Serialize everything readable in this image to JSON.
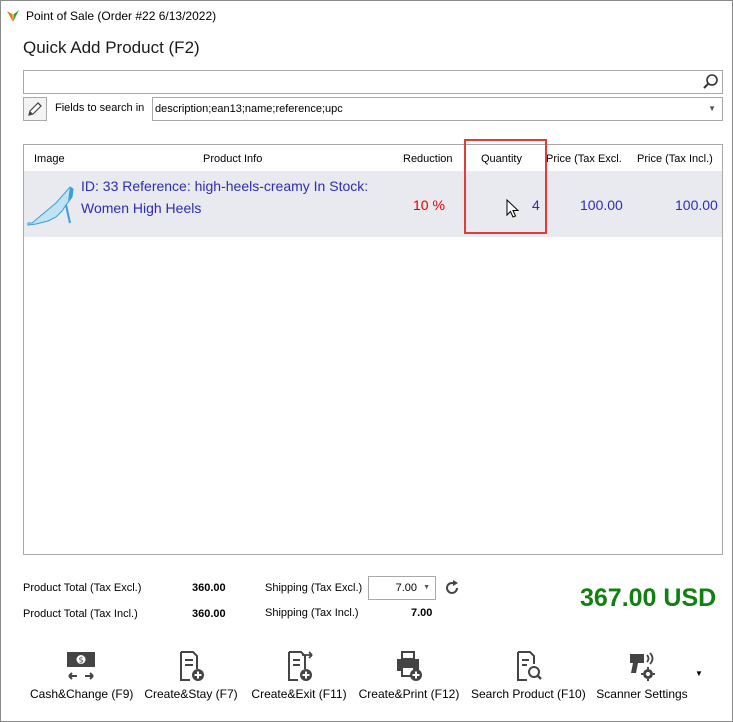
{
  "window": {
    "title": "Point of Sale (Order #22 6/13/2022)"
  },
  "heading": "Quick Add Product (F2)",
  "search": {
    "value": ""
  },
  "fields": {
    "label": "Fields to search in",
    "value": "description;ean13;name;reference;upc"
  },
  "grid": {
    "columns": [
      "Image",
      "Product Info",
      "Reduction",
      "Quantity",
      "Price (Tax Excl.)",
      "Price (Tax Incl.)"
    ],
    "rows": [
      {
        "info_line1": "ID: 33 Reference: high-heels-creamy In Stock:",
        "info_line2": "Women High Heels",
        "reduction": "10 %",
        "quantity": "4",
        "price_excl": "100.00",
        "price_incl": "100.00"
      }
    ]
  },
  "totals": {
    "product_total_excl_label": "Product Total (Tax Excl.)",
    "product_total_excl": "360.00",
    "product_total_incl_label": "Product Total (Tax Incl.)",
    "product_total_incl": "360.00",
    "shipping_excl_label": "Shipping (Tax Excl.)",
    "shipping_excl": "7.00",
    "shipping_incl_label": "Shipping (Tax Incl.)",
    "shipping_incl": "7.00",
    "grand_total": "367.00 USD"
  },
  "toolbar": {
    "cash_change": "Cash&Change (F9)",
    "create_stay": "Create&Stay (F7)",
    "create_exit": "Create&Exit (F11)",
    "create_print": "Create&Print (F12)",
    "search_product": "Search Product (F10)",
    "scanner_settings": "Scanner Settings"
  },
  "colors": {
    "accent_link": "#2d2db0",
    "reduction": "#e00000",
    "grand_total": "#108010",
    "highlight": "#e23b3b"
  }
}
